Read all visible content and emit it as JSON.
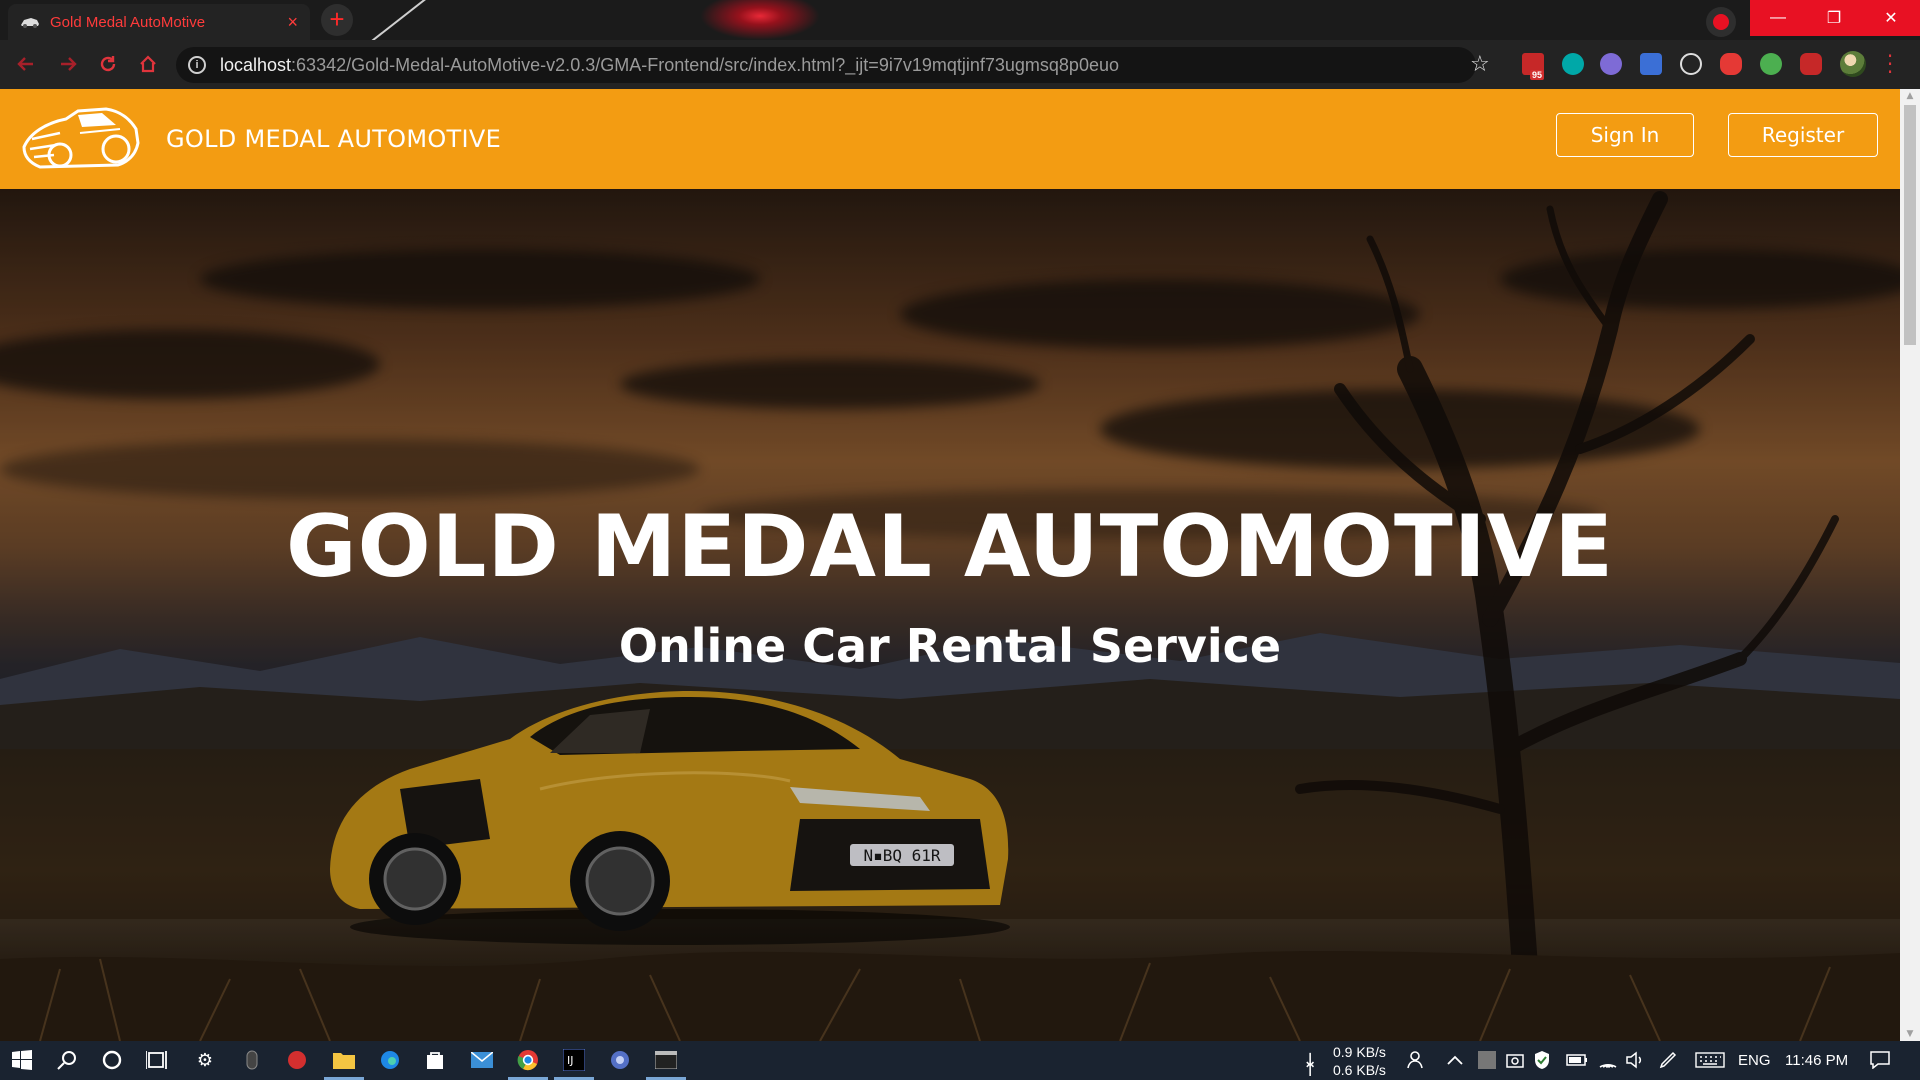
{
  "browser": {
    "tab_title": "Gold Medal AutoMotive",
    "tab_close": "×",
    "new_tab": "+",
    "url_host": "localhost",
    "url_rest": ":63342/Gold-Medal-AutoMotive-v2.0.3/GMA-Frontend/src/index.html?_ijt=9i7v19mqtjinf73ugmsq8p0euo",
    "extension_badge": "95",
    "window_controls": {
      "minimize": "—",
      "restore": "❐",
      "close": "✕"
    }
  },
  "navbar": {
    "brand": "GOLD MEDAL AUTOMOTIVE",
    "sign_in": "Sign In",
    "register": "Register"
  },
  "hero": {
    "title": "GOLD MEDAL AUTOMOTIVE",
    "subtitle": "Online Car Rental Service",
    "plate": "N▪BQ 61R"
  },
  "taskbar": {
    "net_down": "0.9 KB/s",
    "net_up": "0.6 KB/s",
    "language": "ENG",
    "time": "11:46 PM"
  },
  "colors": {
    "navbar": "#f39c12",
    "accent_red": "#e81123",
    "car_yellow": "#d4a020"
  }
}
